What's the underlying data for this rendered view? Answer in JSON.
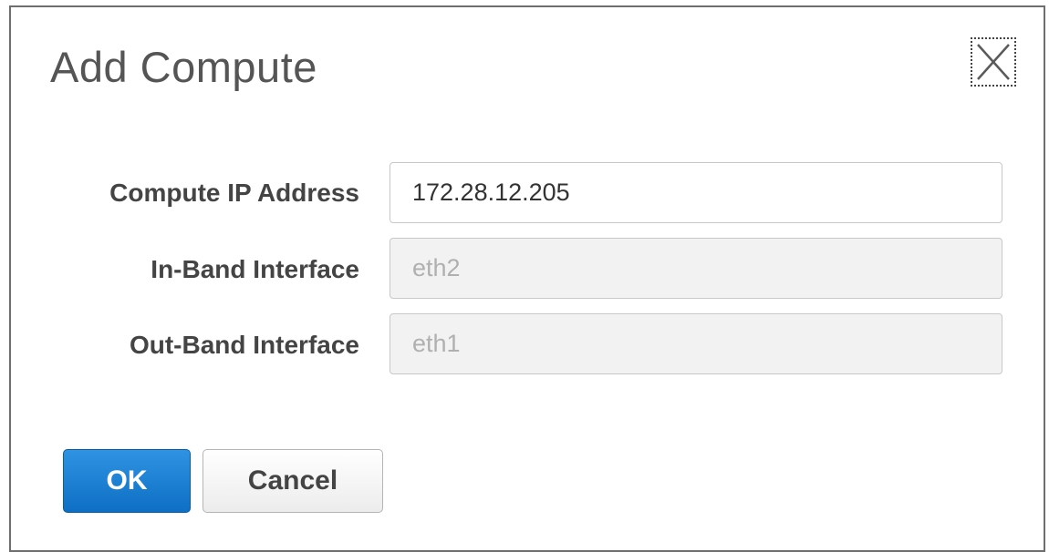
{
  "dialog": {
    "title": "Add Compute",
    "close_icon": "close-x-icon"
  },
  "fields": [
    {
      "label": "Compute IP Address",
      "value": "172.28.12.205",
      "enabled": true
    },
    {
      "label": "In-Band Interface",
      "value": "eth2",
      "enabled": false
    },
    {
      "label": "Out-Band Interface",
      "value": "eth1",
      "enabled": false
    }
  ],
  "buttons": {
    "ok_label": "OK",
    "cancel_label": "Cancel",
    "ok_color": "#1479d2"
  }
}
